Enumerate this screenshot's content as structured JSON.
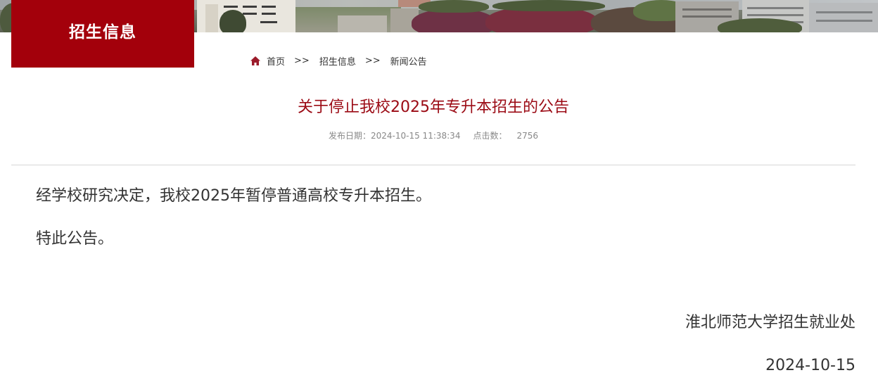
{
  "header": {
    "section_title": "招生信息",
    "brand_color": "#a3000b"
  },
  "breadcrumb": {
    "icon": "home-icon",
    "items": [
      "首页",
      "招生信息",
      "新闻公告"
    ],
    "separator": ">>"
  },
  "article": {
    "title": "关于停止我校2025年专升本招生的公告",
    "title_color": "#9b0a14",
    "meta": {
      "publish_label": "发布日期：",
      "publish_date": "2024-10-15 11:38:34",
      "clicks_label": "点击数：",
      "clicks": "2756"
    },
    "paragraphs": [
      "经学校研究决定，我校2025年暂停普通高校专升本招生。",
      "特此公告。"
    ],
    "signature": "淮北师范大学招生就业处",
    "sign_date": "2024-10-15"
  }
}
